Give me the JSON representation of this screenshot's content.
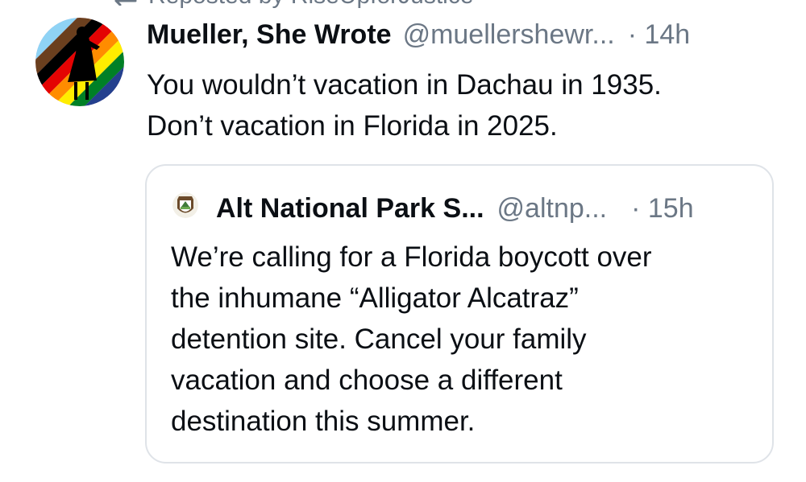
{
  "repost": {
    "label": "Reposted by RiseUpforJustice",
    "icon": "repost-icon"
  },
  "post": {
    "author": "Mueller, She Wrote",
    "handle": "@muellershewr...",
    "time": "· 14h",
    "lines": [
      "You wouldn’t vacation in Dachau in 1935.",
      "Don’t vacation in Florida in 2025."
    ],
    "avatar_icon": "rainbow-silhouette-avatar"
  },
  "quote": {
    "author": "Alt National Park S...",
    "handle": "@altnp...",
    "time": "· 15h",
    "lines": [
      "We’re calling for a Florida boycott over",
      "the inhumane “Alligator Alcatraz”",
      "detention site. Cancel your family",
      "vacation and choose a different",
      "destination this summer."
    ],
    "avatar_icon": "park-badge-avatar"
  },
  "colors": {
    "text": "#0b0f14",
    "secondary": "#6b7785",
    "card_border": "#dfe3e8"
  }
}
